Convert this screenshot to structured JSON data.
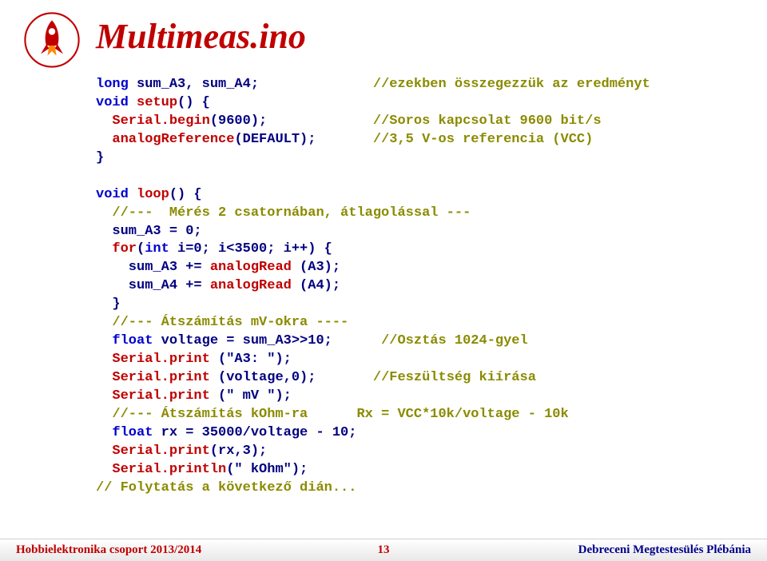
{
  "title": "Multimeas.ino",
  "code": {
    "l1a": "long",
    "l1b": " sum_A3, sum_A4;              ",
    "l1c": "//ezekben összegezzük az eredményt",
    "l2a": "void",
    "l2fn": " setup",
    "l2b": "() {",
    "l3a": "  ",
    "l3fn": "Serial.begin",
    "l3b": "(9600);             ",
    "l3c": "//Soros kapcsolat 9600 bit/s",
    "l4a": "  ",
    "l4fn": "analogReference",
    "l4b": "(DEFAULT);       ",
    "l4c": "//3,5 V-os referencia (VCC)",
    "l5": "}",
    "l6a": "void",
    "l6fn": " loop",
    "l6b": "() {",
    "l7c": "  //---  Mérés 2 csatornában, átlagolással ---",
    "l8": "  sum_A3 = 0;",
    "l9a": "  ",
    "l9k": "for",
    "l9b": "(",
    "l9k2": "int",
    "l9c": " i=0; i<3500; i++) {",
    "l10a": "    sum_A3 += ",
    "l10fn": "analogRead",
    "l10b": " (A3);",
    "l11a": "    sum_A4 += ",
    "l11fn": "analogRead",
    "l11b": " (A4);",
    "l12": "  }",
    "l13c": "  //--- Átszámítás mV-okra ----",
    "l14a": "  ",
    "l14k": "float",
    "l14b": " voltage = sum_A3>>10;      ",
    "l14c": "//Osztás 1024-gyel",
    "l15a": "  ",
    "l15fn": "Serial.print",
    "l15b": " (\"A3: \");",
    "l16a": "  ",
    "l16fn": "Serial.print",
    "l16b": " (voltage,0);       ",
    "l16c": "//Feszültség kiírása",
    "l17a": "  ",
    "l17fn": "Serial.print",
    "l17b": " (\" mV \");",
    "l18c": "  //--- Átszámítás kOhm-ra      Rx = VCC*10k/voltage - 10k",
    "l19a": "  ",
    "l19k": "float",
    "l19b": " rx = 35000/voltage - 10;",
    "l20a": "  ",
    "l20fn": "Serial.print",
    "l20b": "(rx,3);",
    "l21a": "  ",
    "l21fn": "Serial.println",
    "l21b": "(\" kOhm\");",
    "l22c": "// Folytatás a következő dián..."
  },
  "footer": {
    "left": "Hobbielektronika csoport 2013/2014",
    "mid": "13",
    "right": "Debreceni Megtestesülés Plébánia"
  }
}
